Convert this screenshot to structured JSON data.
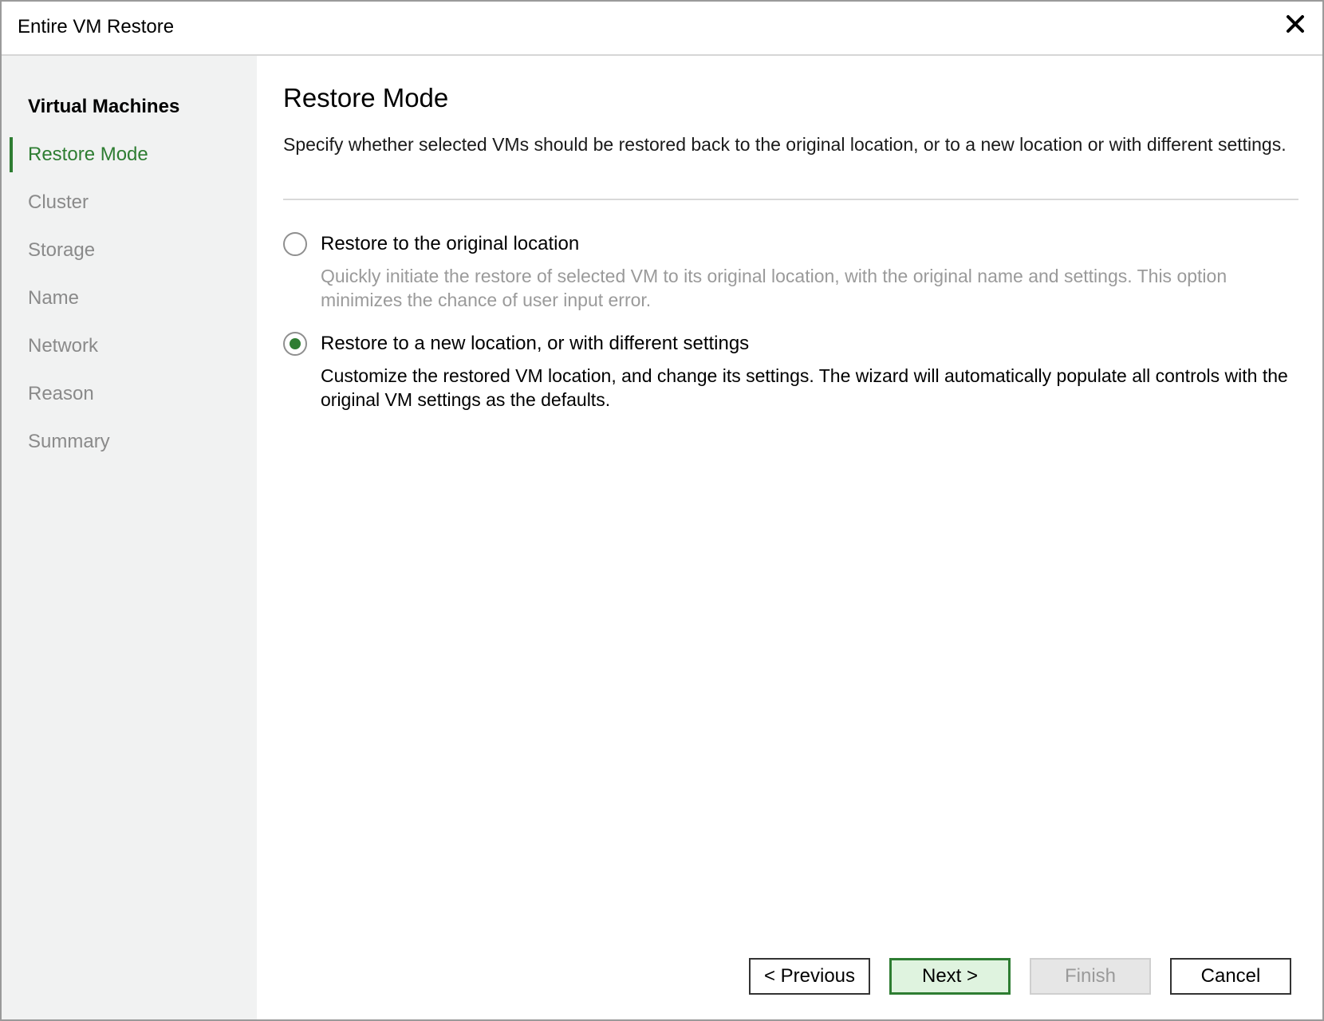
{
  "window": {
    "title": "Entire VM Restore",
    "close_icon": "close-icon"
  },
  "sidebar": {
    "steps": [
      {
        "label": "Virtual Machines",
        "state": "done"
      },
      {
        "label": "Restore Mode",
        "state": "current"
      },
      {
        "label": "Cluster",
        "state": "future"
      },
      {
        "label": "Storage",
        "state": "future"
      },
      {
        "label": "Name",
        "state": "future"
      },
      {
        "label": "Network",
        "state": "future"
      },
      {
        "label": "Reason",
        "state": "future"
      },
      {
        "label": "Summary",
        "state": "future"
      }
    ]
  },
  "main": {
    "title": "Restore Mode",
    "description": "Specify whether selected VMs should be restored back to the original location, or to a new location or with different settings.",
    "options": [
      {
        "label": "Restore to the original location",
        "description": "Quickly initiate the restore of selected VM to its original location, with the original name and settings. This option minimizes the chance of user input error.",
        "selected": false
      },
      {
        "label": "Restore to a new location, or with different settings",
        "description": "Customize the restored VM location, and change its settings. The wizard will automatically populate all controls with the original VM settings as the defaults.",
        "selected": true
      }
    ]
  },
  "footer": {
    "previous_label": "< Previous",
    "next_label": "Next >",
    "finish_label": "Finish",
    "cancel_label": "Cancel"
  },
  "colors": {
    "accent": "#2e7d32",
    "sidebar_bg": "#f1f2f2",
    "next_button_bg": "#dff3df",
    "disabled_text": "#9a9a9a"
  }
}
